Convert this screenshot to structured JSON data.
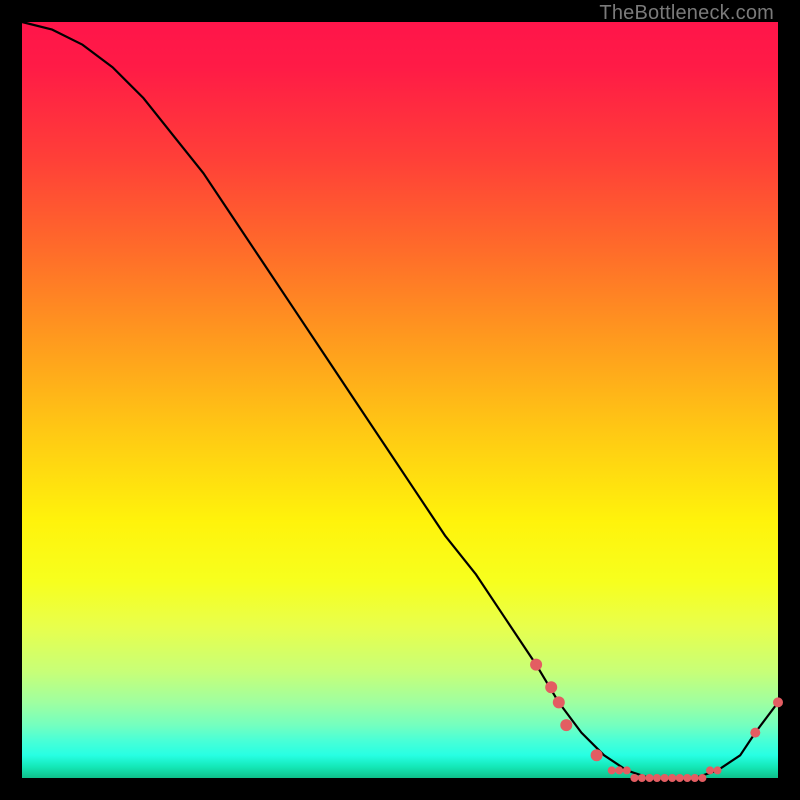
{
  "watermark": "TheBottleneck.com",
  "chart_data": {
    "type": "line",
    "title": "",
    "xlabel": "",
    "ylabel": "",
    "xlim": [
      0,
      100
    ],
    "ylim": [
      0,
      100
    ],
    "series": [
      {
        "name": "bottleneck-curve",
        "x": [
          0,
          4,
          8,
          12,
          16,
          20,
          24,
          28,
          32,
          36,
          40,
          44,
          48,
          52,
          56,
          60,
          64,
          68,
          71,
          74,
          77,
          80,
          83,
          86,
          89,
          92,
          95,
          97,
          100
        ],
        "y": [
          100,
          99,
          97,
          94,
          90,
          85,
          80,
          74,
          68,
          62,
          56,
          50,
          44,
          38,
          32,
          27,
          21,
          15,
          10,
          6,
          3,
          1,
          0,
          0,
          0,
          1,
          3,
          6,
          10
        ]
      }
    ],
    "markers": {
      "name": "marker-points",
      "color": "#e35d62",
      "points": [
        {
          "x": 68,
          "y": 15,
          "r": 6
        },
        {
          "x": 70,
          "y": 12,
          "r": 6
        },
        {
          "x": 71,
          "y": 10,
          "r": 6
        },
        {
          "x": 72,
          "y": 7,
          "r": 6
        },
        {
          "x": 76,
          "y": 3,
          "r": 6
        },
        {
          "x": 78,
          "y": 1,
          "r": 4
        },
        {
          "x": 79,
          "y": 1,
          "r": 4
        },
        {
          "x": 80,
          "y": 1,
          "r": 4
        },
        {
          "x": 81,
          "y": 0,
          "r": 4
        },
        {
          "x": 82,
          "y": 0,
          "r": 4
        },
        {
          "x": 83,
          "y": 0,
          "r": 4
        },
        {
          "x": 84,
          "y": 0,
          "r": 4
        },
        {
          "x": 85,
          "y": 0,
          "r": 4
        },
        {
          "x": 86,
          "y": 0,
          "r": 4
        },
        {
          "x": 87,
          "y": 0,
          "r": 4
        },
        {
          "x": 88,
          "y": 0,
          "r": 4
        },
        {
          "x": 89,
          "y": 0,
          "r": 4
        },
        {
          "x": 90,
          "y": 0,
          "r": 4
        },
        {
          "x": 91,
          "y": 1,
          "r": 4
        },
        {
          "x": 92,
          "y": 1,
          "r": 4
        },
        {
          "x": 97,
          "y": 6,
          "r": 5
        },
        {
          "x": 100,
          "y": 10,
          "r": 5
        }
      ]
    }
  }
}
